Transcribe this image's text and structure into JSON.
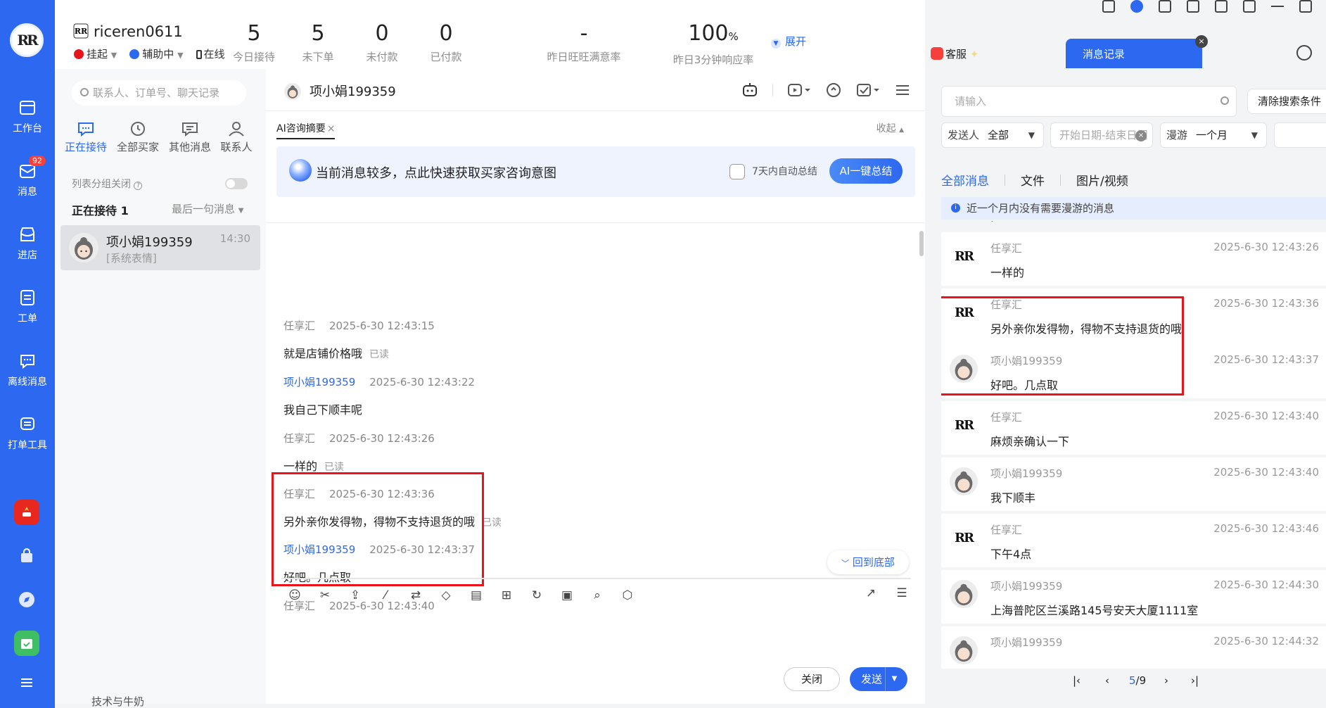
{
  "nav": {
    "logo_text": "RR",
    "items": [
      {
        "label": "工作台",
        "icon": "workbench-icon"
      },
      {
        "label": "消息",
        "icon": "message-icon",
        "badge": "92"
      },
      {
        "label": "进店",
        "icon": "store-icon"
      },
      {
        "label": "工单",
        "icon": "ticket-icon"
      },
      {
        "label": "离线消息",
        "icon": "offline-message-icon"
      },
      {
        "label": "打单工具",
        "icon": "print-tool-icon"
      }
    ]
  },
  "header": {
    "username": "riceren0611",
    "status_suspend": "挂起",
    "status_assist": "辅助中",
    "status_online": "在线",
    "stats": [
      {
        "value": "5",
        "label": "今日接待"
      },
      {
        "value": "5",
        "label": "未下单"
      },
      {
        "value": "0",
        "label": "未付款"
      },
      {
        "value": "0",
        "label": "已付款"
      },
      {
        "value": "-",
        "label": "昨日旺旺满意率"
      },
      {
        "value": "100",
        "unit": "%",
        "label": "昨日3分钟响应率"
      }
    ],
    "expand_label": "展开"
  },
  "contacts": {
    "search_placeholder": "联系人、订单号、聊天记录",
    "tabs": [
      "正在接待",
      "全部买家",
      "其他消息",
      "联系人"
    ],
    "group_toggle_label": "列表分组关闭",
    "receiving_label": "正在接待",
    "receiving_count": "1",
    "sort_label": "最后一句消息",
    "conversation": {
      "name": "项小娟199359",
      "preview": "[系统表情]",
      "time": "14:30"
    },
    "bottom_text": "技术与牛奶"
  },
  "chat": {
    "contact_name": "项小娟199359",
    "ai_tab_label": "AI咨询摘要",
    "collapse_label": "收起",
    "ai_banner_text": "当前消息较多，点此快速获取买家咨询意图",
    "auto_summary_label": "7天内自动总结",
    "ai_button_label": "AI一键总结",
    "messages": [
      {
        "sender": "任享汇",
        "time": "2025-6-30 12:43:15",
        "text": "就是店铺价格哦",
        "read": "已读",
        "buyer": false
      },
      {
        "sender": "项小娟199359",
        "time": "2025-6-30 12:43:22",
        "text": "我自己下顺丰呢",
        "read": "",
        "buyer": true
      },
      {
        "sender": "任享汇",
        "time": "2025-6-30 12:43:26",
        "text": "一样的",
        "read": "已读",
        "buyer": false
      },
      {
        "sender": "任享汇",
        "time": "2025-6-30 12:43:36",
        "text": "另外亲你发得物，得物不支持退货的哦",
        "read": "已读",
        "buyer": false
      },
      {
        "sender": "项小娟199359",
        "time": "2025-6-30 12:43:37",
        "text": "好吧。几点取",
        "read": "",
        "buyer": true
      },
      {
        "sender": "任享汇",
        "time": "2025-6-30 12:43:40",
        "text": "",
        "read": "",
        "buyer": false
      }
    ],
    "back_to_bottom_label": "回到底部",
    "close_label": "关闭",
    "send_label": "发送"
  },
  "right": {
    "tab_service": "客服",
    "tab_history": "消息记录",
    "search_placeholder": "请输入",
    "clear_filters_label": "清除搜索条件",
    "sender_label": "发送人",
    "sender_value": "全部",
    "date_placeholder": "开始日期-结束日期",
    "roam_label": "漫游",
    "roam_value": "一个月",
    "type_tabs": [
      "全部消息",
      "文件",
      "图片/视频"
    ],
    "notice": "近一个月内没有需要漫游的消息",
    "history": [
      {
        "sender": "任享汇",
        "time": "2025-6-30 12:43:26",
        "text": "一样的",
        "shop": true
      },
      {
        "sender": "任享汇",
        "time": "2025-6-30 12:43:36",
        "text": "另外亲你发得物，得物不支持退货的哦",
        "shop": true
      },
      {
        "sender": "项小娟199359",
        "time": "2025-6-30 12:43:37",
        "text": "好吧。几点取",
        "shop": false
      },
      {
        "sender": "任享汇",
        "time": "2025-6-30 12:43:40",
        "text": "麻烦亲确认一下",
        "shop": true
      },
      {
        "sender": "项小娟199359",
        "time": "2025-6-30 12:43:40",
        "text": "我下顺丰",
        "shop": false
      },
      {
        "sender": "任享汇",
        "time": "2025-6-30 12:43:46",
        "text": "下午4点",
        "shop": true
      },
      {
        "sender": "项小娟199359",
        "time": "2025-6-30 12:44:30",
        "text": "上海普陀区兰溪路145号安天大厦1111室",
        "shop": false
      },
      {
        "sender": "项小娟199359",
        "time": "2025-6-30 12:44:32",
        "text": "",
        "shop": false
      }
    ],
    "page_current": "5",
    "page_total": "/9"
  },
  "colors": {
    "accent": "#2d68f0",
    "highlight_border": "#e8141b",
    "badge": "#f5403b"
  }
}
